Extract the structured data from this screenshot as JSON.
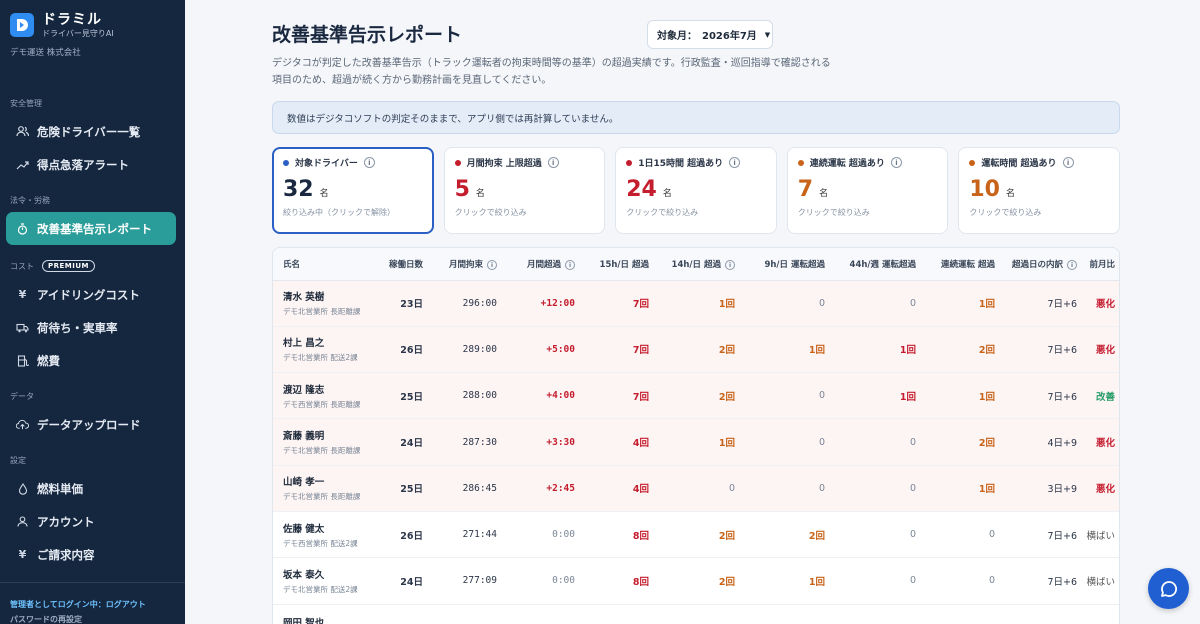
{
  "app": {
    "name": "ドラミル",
    "subtitle": "ドライバー見守りAI",
    "company": "デモ運送 株式会社"
  },
  "sidebar": {
    "sections": [
      {
        "label": "安全管理"
      },
      {
        "label": "法令・労務"
      },
      {
        "label": "コスト",
        "badge": "PREMIUM"
      },
      {
        "label": "データ"
      },
      {
        "label": "設定"
      }
    ],
    "items": [
      {
        "label": "危険ドライバー一覧",
        "icon": "users-icon"
      },
      {
        "label": "得点急落アラート",
        "icon": "trend-icon"
      },
      {
        "label": "改善基準告示レポート",
        "icon": "timer-icon",
        "active": true
      },
      {
        "label": "アイドリングコスト",
        "icon": "yen-icon"
      },
      {
        "label": "荷待ち・実車率",
        "icon": "truck-icon"
      },
      {
        "label": "燃費",
        "icon": "fuel-icon"
      },
      {
        "label": "データアップロード",
        "icon": "upload-icon"
      },
      {
        "label": "燃料単価",
        "icon": "drop-icon"
      },
      {
        "label": "アカウント",
        "icon": "user-icon"
      },
      {
        "label": "ご請求内容",
        "icon": "yen-icon"
      }
    ],
    "footer": {
      "login": "管理者としてログイン中：ログアウト",
      "reset": "パスワードの再設定"
    }
  },
  "page": {
    "title": "改善基準告示レポート",
    "month_label": "対象月：",
    "month_value": "2026年7月",
    "description": "デジタコが判定した改善基準告示（トラック運転者の拘束時間等の基準）の超過実績です。行政監査・巡回指導で確認される項目のため、超過が続く方から勤務計画を見直してください。",
    "notice": "数値はデジタコソフトの判定そのままで、アプリ側では再計算していません。"
  },
  "cards": [
    {
      "label": "対象ドライバー",
      "value": "32",
      "unit": "名",
      "hint": "絞り込み中（クリックで解除）",
      "color": "#2a5fc4",
      "num_color": "#1a2840"
    },
    {
      "label": "月間拘束 上限超過",
      "value": "5",
      "unit": "名",
      "hint": "クリックで絞り込み",
      "color": "#c41d2e",
      "num_color": "#c41d2e"
    },
    {
      "label": "1日15時間 超過あり",
      "value": "24",
      "unit": "名",
      "hint": "クリックで絞り込み",
      "color": "#c41d2e",
      "num_color": "#c41d2e"
    },
    {
      "label": "連続運転 超過あり",
      "value": "7",
      "unit": "名",
      "hint": "クリックで絞り込み",
      "color": "#c8641a",
      "num_color": "#c8641a"
    },
    {
      "label": "運転時間 超過あり",
      "value": "10",
      "unit": "名",
      "hint": "クリックで絞り込み",
      "color": "#c8641a",
      "num_color": "#c8641a"
    }
  ],
  "table": {
    "headers": [
      "氏名",
      "稼働日数",
      "月間拘束",
      "月間超過",
      "15h/日 超過",
      "14h/日 超過",
      "9h/日 運転超過",
      "44h/週 運転超過",
      "連続運転 超過",
      "超過日の内訳",
      "前月比"
    ],
    "rows": [
      {
        "name": "清水 英樹",
        "dept": "デモ北営業所 長距離課",
        "days": "23日",
        "hours": "296:00",
        "over": "+12:00",
        "h15": "7回",
        "h14": "1回",
        "d9": "0",
        "w44": "0",
        "cont": "1回",
        "breakdown": "7日+6",
        "trend": "悪化",
        "hl": true
      },
      {
        "name": "村上 昌之",
        "dept": "デモ北営業所 配送2課",
        "days": "26日",
        "hours": "289:00",
        "over": "+5:00",
        "h15": "7回",
        "h14": "2回",
        "d9": "1回",
        "w44": "1回",
        "cont": "2回",
        "breakdown": "7日+6",
        "trend": "悪化",
        "hl": true
      },
      {
        "name": "渡辺 隆志",
        "dept": "デモ西営業所 長距離課",
        "days": "25日",
        "hours": "288:00",
        "over": "+4:00",
        "h15": "7回",
        "h14": "2回",
        "d9": "0",
        "w44": "1回",
        "cont": "1回",
        "breakdown": "7日+6",
        "trend": "改善",
        "hl": true
      },
      {
        "name": "斎藤 義明",
        "dept": "デモ北営業所 長距離課",
        "days": "24日",
        "hours": "287:30",
        "over": "+3:30",
        "h15": "4回",
        "h14": "1回",
        "d9": "0",
        "w44": "0",
        "cont": "2回",
        "breakdown": "4日+9",
        "trend": "悪化",
        "hl": true
      },
      {
        "name": "山崎 孝一",
        "dept": "デモ北営業所 長距離課",
        "days": "25日",
        "hours": "286:45",
        "over": "+2:45",
        "h15": "4回",
        "h14": "0",
        "d9": "0",
        "w44": "0",
        "cont": "1回",
        "breakdown": "3日+9",
        "trend": "悪化",
        "hl": true
      },
      {
        "name": "佐藤 健太",
        "dept": "デモ西営業所 配送2課",
        "days": "26日",
        "hours": "271:44",
        "over": "0:00",
        "h15": "8回",
        "h14": "2回",
        "d9": "2回",
        "w44": "0",
        "cont": "0",
        "breakdown": "7日+6",
        "trend": "横ばい",
        "hl": false
      },
      {
        "name": "坂本 泰久",
        "dept": "デモ北営業所 配送2課",
        "days": "24日",
        "hours": "277:09",
        "over": "0:00",
        "h15": "8回",
        "h14": "2回",
        "d9": "1回",
        "w44": "0",
        "cont": "0",
        "breakdown": "7日+6",
        "trend": "横ばい",
        "hl": false
      },
      {
        "name": "岡田 智也",
        "dept": "",
        "days": "",
        "hours": "",
        "over": "",
        "h15": "",
        "h14": "",
        "d9": "",
        "w44": "",
        "cont": "",
        "breakdown": "",
        "trend": "",
        "hl": false
      }
    ]
  }
}
